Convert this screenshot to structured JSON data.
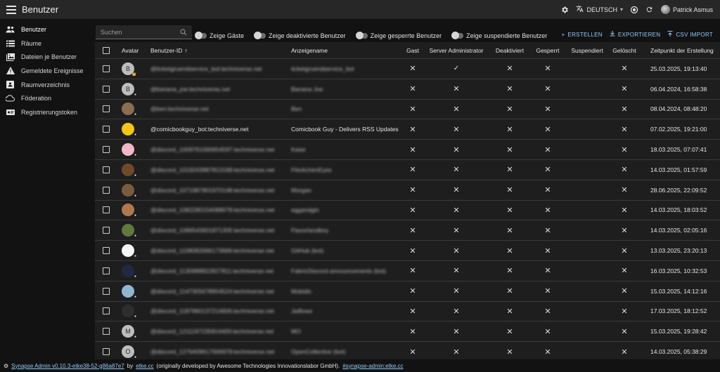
{
  "appbar": {
    "title": "Benutzer",
    "language": "DEUTSCH",
    "user_name": "Patrick Asmus",
    "icons": [
      "settings-icon",
      "translate-icon",
      "theme-icon",
      "refresh-icon"
    ]
  },
  "sidebar": {
    "items": [
      {
        "label": "Benutzer",
        "icon": "users-icon"
      },
      {
        "label": "Räume",
        "icon": "list-icon"
      },
      {
        "label": "Dateien je Benutzer",
        "icon": "media-icon"
      },
      {
        "label": "Gemeldete Ereignisse",
        "icon": "warning-icon"
      },
      {
        "label": "Raumverzeichnis",
        "icon": "directory-icon"
      },
      {
        "label": "Föderation",
        "icon": "cloud-icon"
      },
      {
        "label": "Registrierungstoken",
        "icon": "token-icon"
      }
    ]
  },
  "toolbar": {
    "search_placeholder": "Suchen",
    "toggles": [
      "Zeige Gäste",
      "Zeige deaktivierte Benutzer",
      "Zeige gesperrte Benutzer",
      "Zeige suspendierte Benutzer"
    ],
    "actions": [
      "ERSTELLEN",
      "EXPORTIEREN",
      "CSV IMPORT"
    ]
  },
  "table": {
    "columns": {
      "avatar": "Avatar",
      "user_id": "Benutzer-ID",
      "display_name": "Anzeigename",
      "guest": "Gast",
      "admin": "Server Administrator",
      "deactivated": "Deaktiviert",
      "locked": "Gesperrt",
      "suspended": "Suspendiert",
      "erased": "Gelöscht",
      "created": "Zeitpunkt der Erstellung"
    },
    "rows": [
      {
        "user_id": "@ticketgruendservice_bot:techniverse.net",
        "name": "ticketgruendservice_bot",
        "admin": true,
        "created": "25.03.2025, 19:13:40",
        "blur": true,
        "avatar": {
          "letter": "B",
          "color": "#bdbdbd",
          "badge": "👑"
        }
      },
      {
        "user_id": "@banana_joe:techniverse.net",
        "name": "Banana Joe",
        "admin": false,
        "created": "06.04.2024, 16:58:38",
        "blur": true,
        "avatar": {
          "letter": "B",
          "color": "#bdbdbd",
          "badge": "●"
        }
      },
      {
        "user_id": "@ben:techniverse.net",
        "name": "Ben",
        "admin": false,
        "created": "08.04.2024, 08:48:20",
        "blur": true,
        "avatar": {
          "letter": "",
          "color": "#8a6e4f",
          "badge": "●"
        }
      },
      {
        "user_id": "@comicbookguy_bot:techniverse.net",
        "name": "Comicbook Guy - Delivers RSS Updates",
        "admin": false,
        "created": "07.02.2025, 19:21:00",
        "blur": false,
        "avatar": {
          "letter": "",
          "color": "#f5c518",
          "badge": "●"
        }
      },
      {
        "user_id": "@discord_1009761060654597:techniverse.net",
        "name": "Kaiwi",
        "admin": false,
        "created": "18.03.2025, 07:07:41",
        "blur": true,
        "avatar": {
          "letter": "",
          "color": "#f2b8c6",
          "badge": "●"
        }
      },
      {
        "user_id": "@discord_1019243987813168:techniverse.net",
        "name": "FlöckchenEyes",
        "admin": false,
        "created": "14.03.2025, 01:57:59",
        "blur": true,
        "avatar": {
          "letter": "",
          "color": "#6d4a2a",
          "badge": "●"
        }
      },
      {
        "user_id": "@discord_1071987801970148:techniverse.net",
        "name": "Morgan",
        "admin": false,
        "created": "28.06.2025, 22:09:52",
        "blur": true,
        "avatar": {
          "letter": "",
          "color": "#7a5c3c",
          "badge": "●"
        }
      },
      {
        "user_id": "@discord_1082280154088078:techniverse.net",
        "name": "eggandgin",
        "admin": false,
        "created": "14.03.2025, 18:03:52",
        "blur": true,
        "avatar": {
          "letter": "",
          "color": "#b07850",
          "badge": "●"
        }
      },
      {
        "user_id": "@discord_1086543601871305:techniverse.net",
        "name": "Flavorlandboy",
        "admin": false,
        "created": "14.03.2025, 02:05:16",
        "blur": true,
        "avatar": {
          "letter": "",
          "color": "#5f7a3a",
          "badge": "●"
        }
      },
      {
        "user_id": "@discord_1108082666173668:techniverse.net",
        "name": "GitHub (bot)",
        "admin": false,
        "created": "13.03.2025, 23:20:13",
        "blur": true,
        "avatar": {
          "letter": "",
          "color": "#f5f5f5",
          "badge": "●"
        }
      },
      {
        "user_id": "@discord_1130988822827811:techniverse.net",
        "name": "FabricDiscord announcements (bot)",
        "admin": false,
        "created": "16.03.2025, 10:32:53",
        "blur": true,
        "avatar": {
          "letter": "",
          "color": "#1e2a44",
          "badge": "●"
        }
      },
      {
        "user_id": "@discord_1147305678954524:techniverse.net",
        "name": "Mobidic",
        "admin": false,
        "created": "15.03.2025, 14:12:16",
        "blur": true,
        "avatar": {
          "letter": "",
          "color": "#8fb7d0",
          "badge": "●"
        }
      },
      {
        "user_id": "@discord_1187960137214606:techniverse.net",
        "name": "Jaiflows",
        "admin": false,
        "created": "17.03.2025, 18:12:52",
        "blur": true,
        "avatar": {
          "letter": "",
          "color": "#2e2e2e",
          "badge": "●"
        }
      },
      {
        "user_id": "@discord_1211197235814400:techniverse.net",
        "name": "MO",
        "admin": false,
        "created": "15.03.2025, 19:28:42",
        "blur": true,
        "avatar": {
          "letter": "M",
          "color": "#bdbdbd",
          "badge": "●"
        }
      },
      {
        "user_id": "@discord_1276409617006978:techniverse.net",
        "name": "OpenCollective (bot)",
        "admin": false,
        "created": "14.03.2025, 05:38:29",
        "blur": true,
        "avatar": {
          "letter": "O",
          "color": "#bdbdbd",
          "badge": "●"
        }
      }
    ]
  },
  "footer": {
    "version": "Synapse Admin v0.10.3-etke38-52-g86a87e7",
    "by": "by",
    "etke": "etke.cc",
    "original": "(originally developed by Awesome Technologies Innovationslabor GmbH).",
    "room": "#synapse-admin:etke.cc"
  }
}
